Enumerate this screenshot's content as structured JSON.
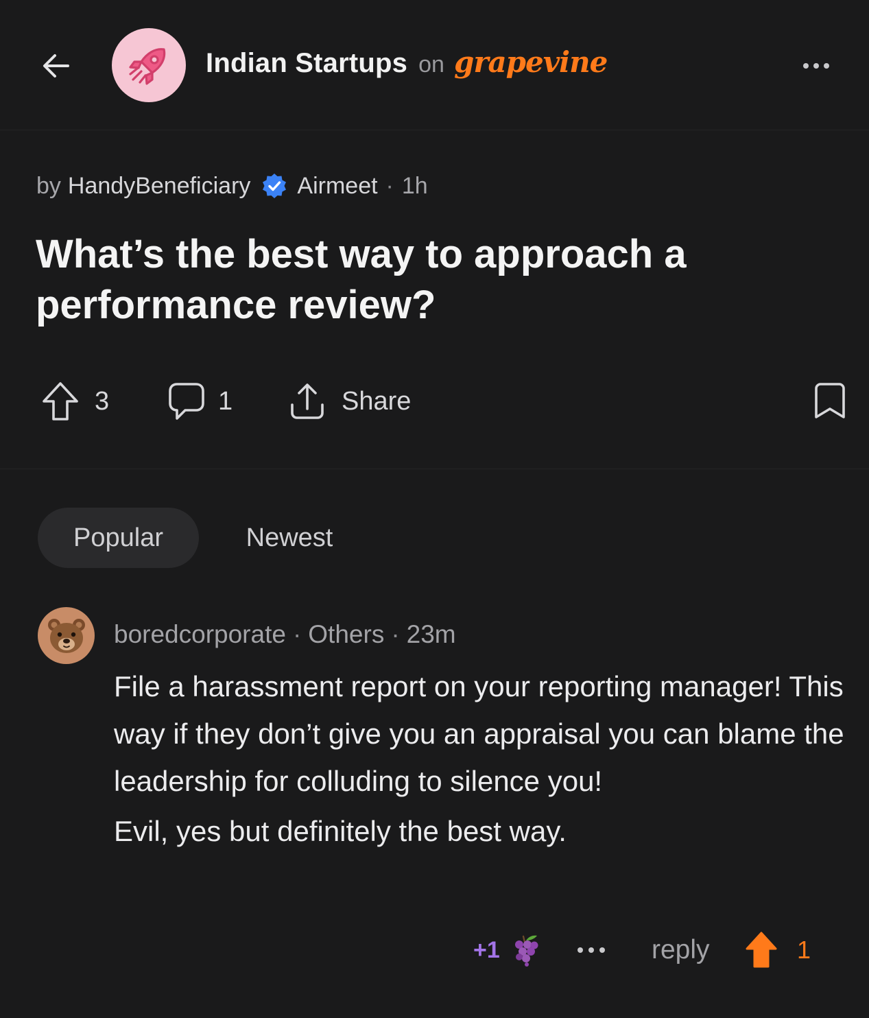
{
  "header": {
    "community_name": "Indian Startups",
    "on_text": "on",
    "brand": "grapevine",
    "community_icon": "rocket-icon",
    "colors": {
      "brand": "#ff7a1a",
      "avatar_bg": "#f6c6d4",
      "rocket": "#e44d7a"
    }
  },
  "post": {
    "by_label": "by",
    "author": "HandyBeneficiary",
    "company": "Airmeet",
    "time": "1h",
    "title": "What’s the best way to approach a performance review?",
    "upvotes": "3",
    "comments": "1",
    "share_label": "Share",
    "colors": {
      "verified": "#3b82f6"
    }
  },
  "sort_tabs": [
    {
      "label": "Popular",
      "active": true
    },
    {
      "label": "Newest",
      "active": false
    }
  ],
  "comment": {
    "author": "boredcorporate",
    "company": "Others",
    "time": "23m",
    "avatar_icon": "bear-icon",
    "body_paragraph_1": "File a harassment report on your reporting manager! This way if they don’t give you an appraisal you can blame the leadership for colluding to silence you!",
    "body_paragraph_2": "Evil, yes but definitely the best way.",
    "plus_one": "+1",
    "reply_label": "reply",
    "upvotes": "1",
    "colors": {
      "plus_one": "#a374e8",
      "upvote": "#ff7a1a",
      "avatar_bg": "#c88c67"
    }
  }
}
